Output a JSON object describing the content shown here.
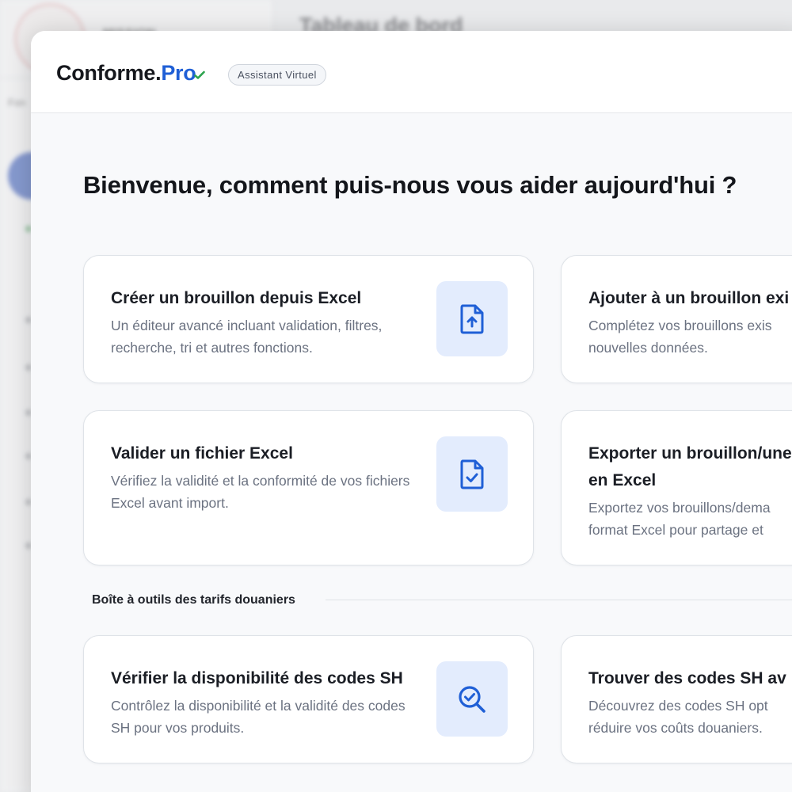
{
  "background": {
    "org_name": "MISSION",
    "sidebar_label": "Fon",
    "page_title": "Tableau de bord"
  },
  "header": {
    "brand_main": "Conforme.",
    "brand_accent": "Pro",
    "badge": "Assistant Virtuel"
  },
  "welcome": "Bienvenue, comment puis-nous vous aider aujourd'hui ?",
  "cards": [
    {
      "title": "Créer un brouillon depuis Excel",
      "description": "Un éditeur avancé incluant validation, filtres, recherche, tri et autres fonctions.",
      "icon": "file-upload-icon"
    },
    {
      "title": "Ajouter à un brouillon exi",
      "description_line1": "Complétez vos brouillons exis",
      "description_line2": "nouvelles données."
    },
    {
      "title": "Valider un fichier Excel",
      "description": "Vérifiez la validité et la conformité de vos fichiers Excel avant import.",
      "icon": "file-check-icon"
    },
    {
      "title_line1": "Exporter un brouillon/une",
      "title_line2": "en Excel",
      "description_line1": "Exportez vos brouillons/dema",
      "description_line2": "format Excel pour partage et"
    }
  ],
  "toolbox": {
    "section_label": "Boîte à outils des tarifs douaniers",
    "cards": [
      {
        "title": "Vérifier la disponibilité des codes SH",
        "description": "Contrôlez la disponibilité et la validité des codes SH pour vos produits.",
        "icon": "search-check-icon"
      },
      {
        "title": "Trouver des codes SH av",
        "description_line1": "Découvrez des codes SH opt",
        "description_line2": "réduire vos coûts douaniers."
      }
    ]
  },
  "colors": {
    "accent": "#1f5fd6",
    "icon_bg": "#e3ecfd",
    "check": "#2ea44f"
  }
}
